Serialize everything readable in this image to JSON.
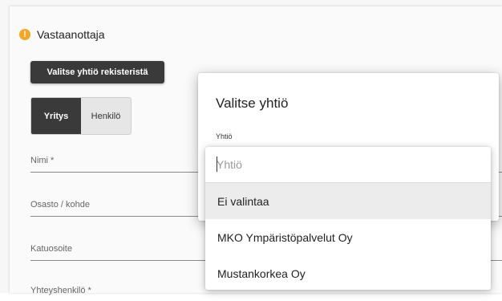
{
  "section": {
    "title": "Vastaanottaja",
    "warning_icon": "!"
  },
  "registry_button": {
    "label": "Valitse yhtiö rekisteristä"
  },
  "type_toggle": {
    "company_label": "Yritys",
    "person_label": "Henkilö",
    "selected": "Yritys"
  },
  "fields": {
    "name_label": "Nimi *",
    "department_label": "Osasto / kohde",
    "street_label": "Katuosoite",
    "contact_label": "Yhteyshenkilö *"
  },
  "dialog": {
    "title": "Valitse yhtiö",
    "field_label": "Yhtiö"
  },
  "dropdown": {
    "search_placeholder": "Yhtiö",
    "search_value": "",
    "options": [
      "Ei valintaa",
      "MKO Ympäristöpalvelut Oy",
      "Mustankorkea Oy"
    ]
  },
  "colors": {
    "accent_dark": "#3a3a3a",
    "warning": "#f5a623"
  }
}
